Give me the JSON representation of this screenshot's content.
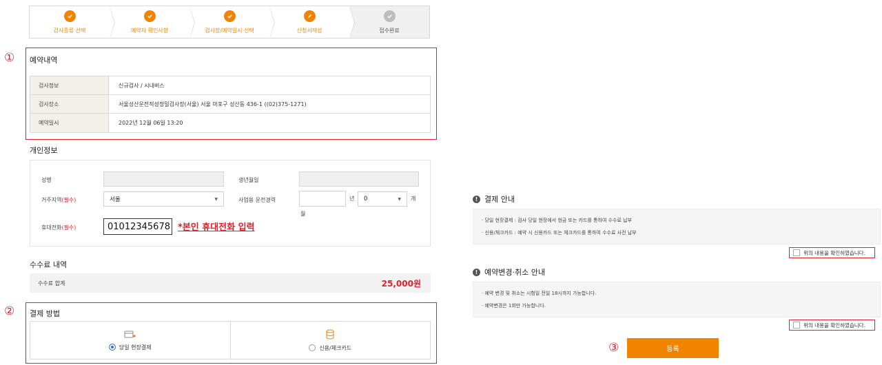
{
  "steps": [
    {
      "label": "검사종류 선택"
    },
    {
      "label": "예약자 확인사항"
    },
    {
      "label": "검사장/예약일시 선택"
    },
    {
      "label": "신청서작성"
    },
    {
      "label": "접수완료"
    }
  ],
  "markers": {
    "one": "①",
    "two": "②",
    "three": "③"
  },
  "reservation": {
    "title": "예약내역",
    "rows": [
      {
        "head": "검사정보",
        "value": "신규검사 / 시내버스"
      },
      {
        "head": "검사장소",
        "value": "서울성산운전적성정밀검사장(서울) 서울 마포구 성산동 436-1 ((02)375-1271)"
      },
      {
        "head": "예약일시",
        "value": "2022년 12월 06일 13:20"
      }
    ]
  },
  "personal": {
    "title": "개인정보",
    "name_label": "성명",
    "birth_label": "생년월일",
    "region_label": "거주지역",
    "required": "(필수)",
    "region_value": "서울",
    "career_label": "사업용 운전경력",
    "year_unit": "년",
    "month_value": "0",
    "month_unit": "개",
    "month_unit2": "월",
    "phone_label": "휴대전화",
    "phone_value": "01012345678",
    "phone_note": "*본인 휴대전화 입력"
  },
  "fee": {
    "title": "수수료 내역",
    "total_label": "수수료 합계",
    "total_value": "25,000원"
  },
  "payment": {
    "title": "결제 방법",
    "option1": "당일 현장결제",
    "option2": "신용/체크카드"
  },
  "payment_info": {
    "title": "결제 안내",
    "lines": [
      "· 당일 현장결제 : 검사 당일 현장에서 현금 또는 카드를 통하여 수수료 납부",
      "· 신용/체크카드 : 예약 시 신용카드 또는 체크카드를 통하여 수수료 사전 납부"
    ],
    "confirm": "위의 내용을 확인하였습니다."
  },
  "change_info": {
    "title": "예약변경·취소 안내",
    "lines": [
      "· 예약 변경 및 취소는 시험일 전일 18시까지 가능합니다.",
      "· 예약변경은 1회만 가능합니다."
    ],
    "confirm": "위의 내용을 확인하였습니다."
  },
  "submit_label": "등록",
  "colors": {
    "accent": "#f08300",
    "annotation": "#e0202a"
  }
}
